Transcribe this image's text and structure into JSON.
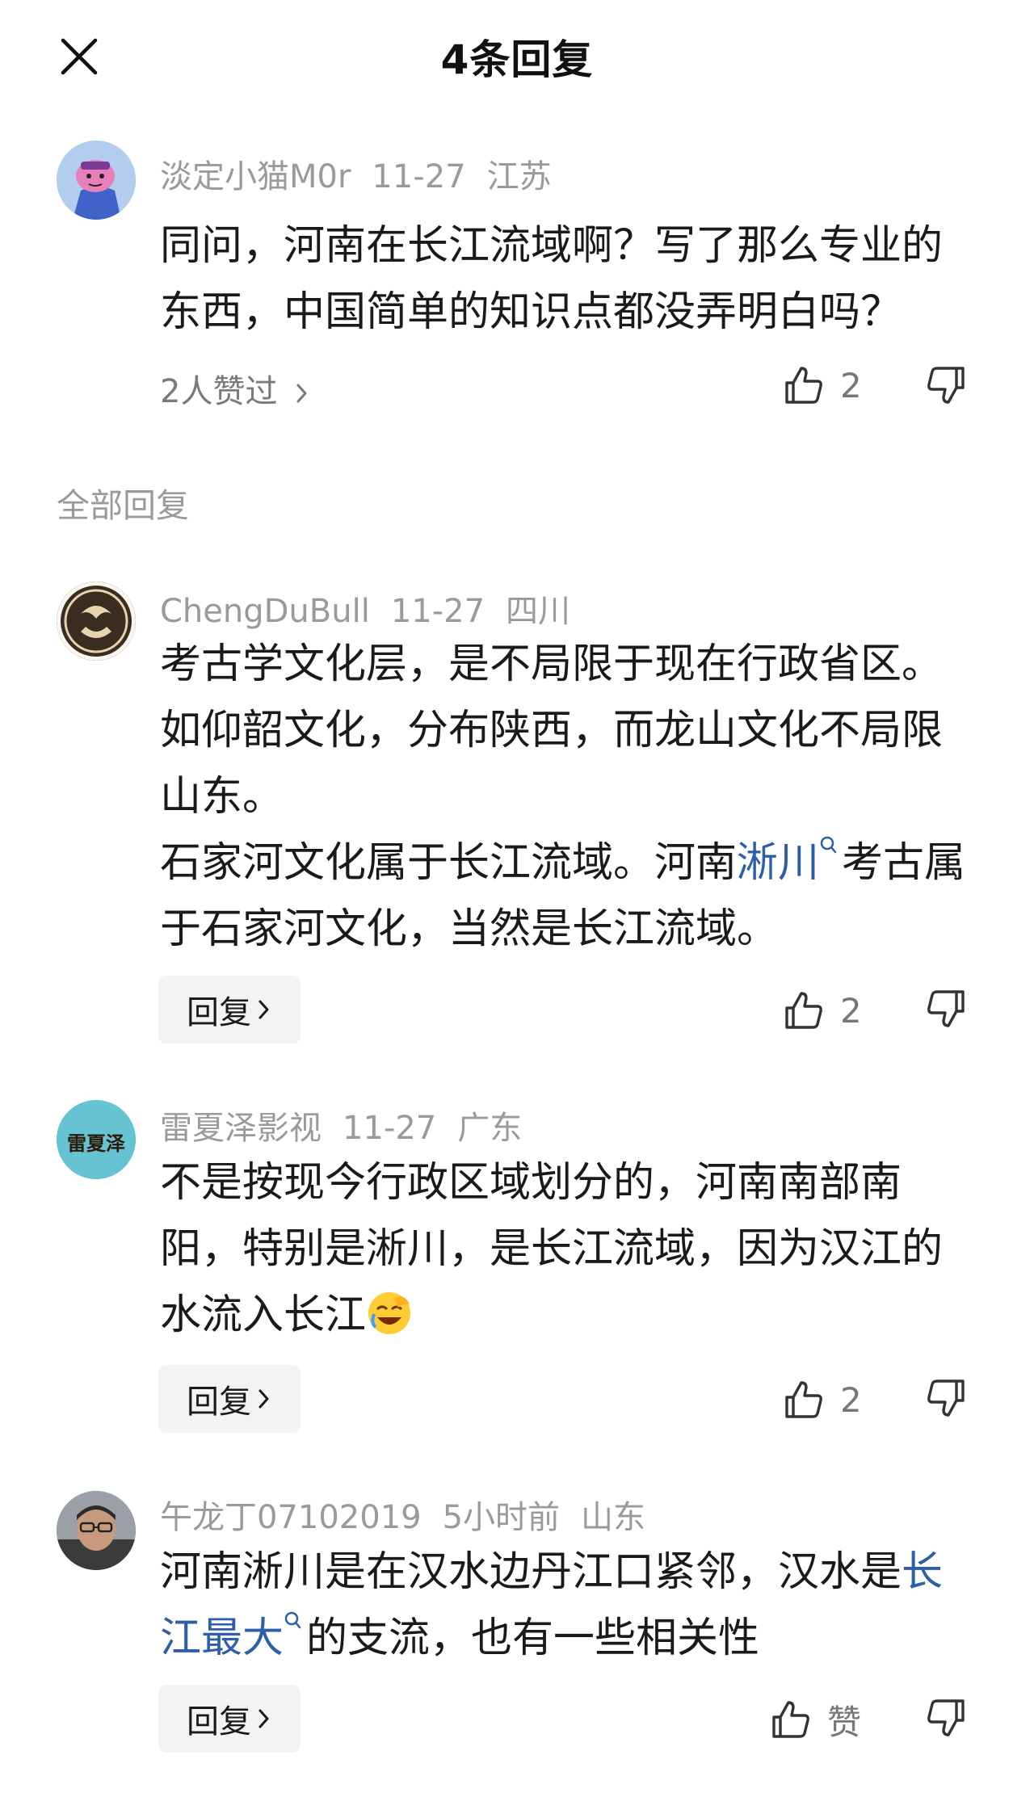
{
  "header": {
    "title": "4条回复"
  },
  "original": {
    "username": "淡定小猫M0r",
    "date": "11-27",
    "location": "江苏",
    "text": "同问，河南在长江流域啊？写了那么专业的东西，中国简单的知识点都没弄明白吗？",
    "likes_by": "2人赞过",
    "like_count": "2"
  },
  "section_label": "全部回复",
  "replies": [
    {
      "username": "ChengDuBull",
      "date": "11-27",
      "location": "四川",
      "text_1": "考古学文化层，是不局限于现在行政省区。如仰韶文化，分布陕西，而龙山文化不局限山东。",
      "text_2a": "石家河文化属于长江流域。河南",
      "link": "淅川",
      "text_2b": "考古属于石家河文化，当然是长江流域。",
      "reply_label": "回复",
      "like_count": "2"
    },
    {
      "username": "雷夏泽影视",
      "date": "11-27",
      "location": "广东",
      "avatar_text": "雷夏泽",
      "text": "不是按现今行政区域划分的，河南南部南阳，特别是淅川，是长江流域，因为汉江的水流入长江",
      "emoji": "laughing-emoji",
      "reply_label": "回复",
      "like_count": "2"
    },
    {
      "username": "午龙丁07102019",
      "date": "5小时前",
      "location": "山东",
      "text_a": "河南淅川是在汉水边丹江口紧邻，汉水是",
      "link": "长江最大",
      "text_b": "的支流，也有一些相关性",
      "reply_label": "回复",
      "like_label": "赞"
    }
  ],
  "icons": {
    "close": "close-icon",
    "thumb_up": "thumbs-up-icon",
    "thumb_down": "thumbs-down-icon",
    "chevron": "chevron-right-icon",
    "search": "search-icon"
  },
  "colors": {
    "link": "#2c5fa8",
    "meta": "#9a9a9a",
    "reply_bg": "#f3f3f3"
  }
}
